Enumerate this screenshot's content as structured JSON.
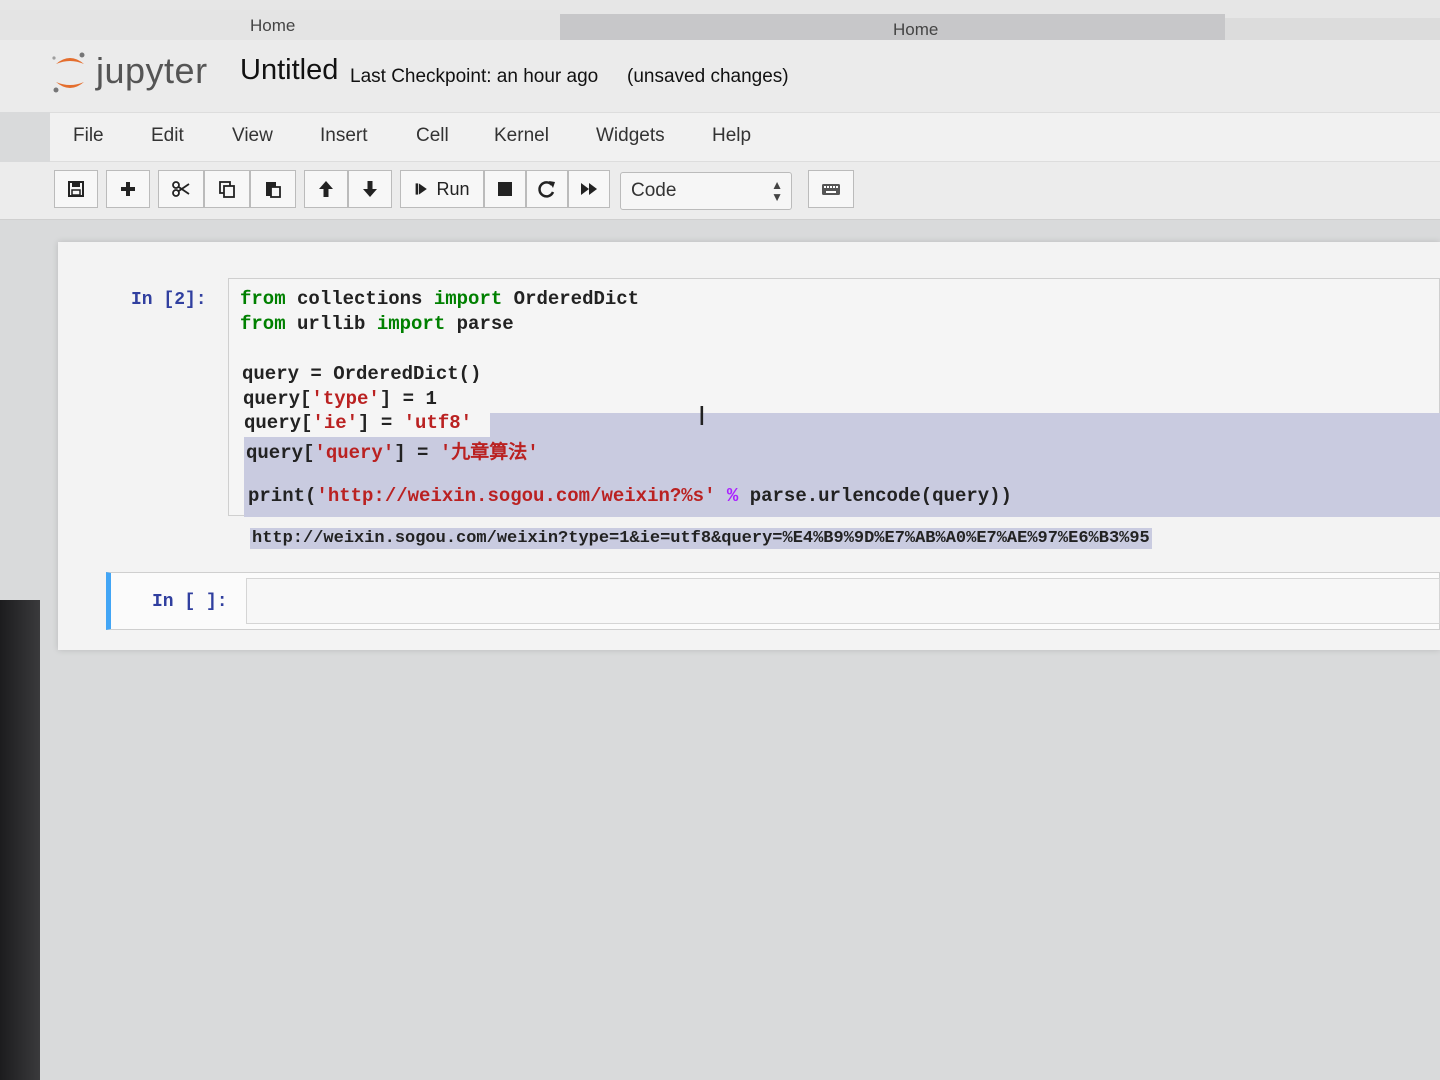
{
  "browser": {
    "tabs": [
      "Home",
      "Home",
      ""
    ]
  },
  "header": {
    "logo_text": "jupyter",
    "notebook_name": "Untitled",
    "checkpoint": "Last Checkpoint: an hour ago",
    "status": "(unsaved changes)"
  },
  "menu": [
    "File",
    "Edit",
    "View",
    "Insert",
    "Cell",
    "Kernel",
    "Widgets",
    "Help"
  ],
  "toolbar": {
    "run_label": "Run",
    "cell_type": "Code",
    "icons": [
      "save-icon",
      "plus-icon",
      "cut-icon",
      "copy-icon",
      "paste-icon",
      "arrow-up-icon",
      "arrow-down-icon",
      "run-icon",
      "stop-icon",
      "restart-icon",
      "fast-forward-icon",
      "keyboard-icon"
    ]
  },
  "cells": {
    "cell1": {
      "prompt": "In [2]:",
      "output": "http://weixin.sogou.com/weixin?type=1&ie=utf8&query=%E4%B9%9D%E7%AB%A0%E7%AE%97%E6%B3%95"
    },
    "cell2": {
      "prompt": "In [ ]:"
    }
  },
  "code_tokens": {
    "from": "from",
    "import": "import",
    "collections": " collections ",
    "OrderedDict": " OrderedDict",
    "urllib": " urllib ",
    "parse": " parse",
    "l4": "query = OrderedDict()",
    "l5a": "query[",
    "l5b": "'type'",
    "l5c": "] = 1",
    "l6a": "query[",
    "l6b": "'ie'",
    "l6c": "] = ",
    "l6d": "'utf8'",
    "l7a": "query[",
    "l7b": "'query'",
    "l7c": "] = ",
    "l7d": "'九章算法'",
    "l9a": "print(",
    "l9b": "'http://weixin.sogou.com/weixin?%s'",
    "l9c": " % ",
    "l9d": "parse.urlencode(query))"
  },
  "colors": {
    "keyword": "#008000",
    "string": "#ba2121",
    "prompt": "#303f9f",
    "selection": "#c9cbe0",
    "active_cell_border": "#42a5f5"
  }
}
